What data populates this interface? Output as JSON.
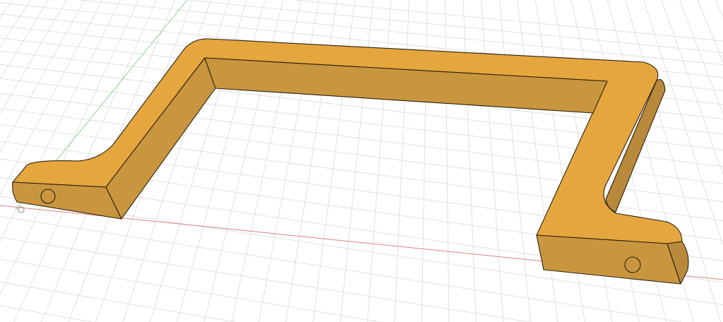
{
  "viewport": {
    "background": "#ffffff",
    "grid_color": "#d9d9d9",
    "x_axis_color": "#e08080",
    "y_axis_color": "#8fd08f"
  },
  "model": {
    "name": "handle",
    "top_color": "#E6A63E",
    "side_color": "#C9963F",
    "dark_side_color": "#B8893A",
    "edge_color": "#2a2010",
    "hole_count": 2
  }
}
